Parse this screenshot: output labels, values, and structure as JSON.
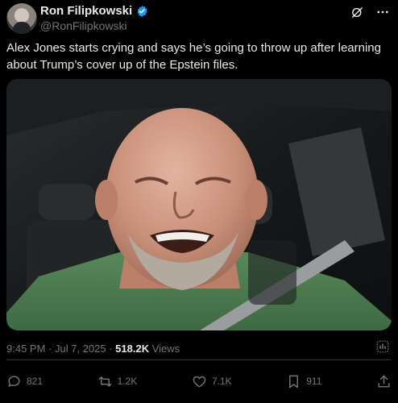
{
  "user": {
    "name": "Ron Filipkowski",
    "handle": "@RonFilipkowski"
  },
  "tweet": {
    "text": "Alex Jones starts crying and says he’s going to throw up after learning about Trump’s cover up of the Epstein files."
  },
  "meta": {
    "time": "9:45 PM",
    "separator": " · ",
    "date": "Jul 7, 2025",
    "views_count": "518.2K",
    "views_label": " Views"
  },
  "actions": {
    "replies": "821",
    "reposts": "1.2K",
    "likes": "7.1K",
    "bookmarks": "911"
  },
  "colors": {
    "background": "#000000",
    "text": "#e7e9ea",
    "muted": "#71767b",
    "verified": "#1d9bf0"
  },
  "icons": [
    "verified-badge-icon",
    "grok-icon",
    "more-icon",
    "reply-icon",
    "repost-icon",
    "like-icon",
    "bookmark-icon",
    "share-icon",
    "analytics-icon"
  ]
}
